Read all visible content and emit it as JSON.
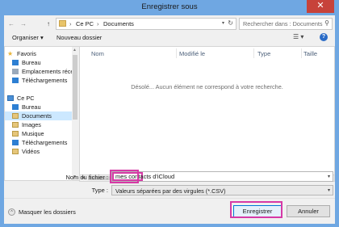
{
  "window": {
    "title": "Enregistrer sous",
    "close_glyph": "✕"
  },
  "address": {
    "back_glyph": "←",
    "forward_glyph": "→",
    "up_glyph": "↑",
    "crumbs": [
      "Ce PC",
      "Documents"
    ],
    "separator": "›",
    "dropdown_glyph": "▾",
    "refresh_glyph": "↻"
  },
  "search": {
    "placeholder": "Rechercher dans : Documents",
    "icon_glyph": "⚲"
  },
  "toolbar": {
    "organize_label": "Organiser ▾",
    "new_folder_label": "Nouveau dossier",
    "view_glyph": "☰ ▾",
    "help_glyph": "?"
  },
  "nav": {
    "items": [
      {
        "label": "Favoris",
        "icon": "star-icon",
        "color": "#e8b43a"
      },
      {
        "label": "Bureau",
        "icon": "desktop-icon",
        "color": "#2d7fd3"
      },
      {
        "label": "Emplacements récents",
        "icon": "recent-icon",
        "color": "#9aa9bb"
      },
      {
        "label": "Téléchargements",
        "icon": "download-icon",
        "color": "#2d7fd3"
      },
      {
        "label": "Ce PC",
        "icon": "computer-icon",
        "color": "#4a8fd6"
      },
      {
        "label": "Bureau",
        "icon": "desktop-icon",
        "color": "#2d7fd3"
      },
      {
        "label": "Documents",
        "icon": "documents-icon",
        "color": "#e6c67a",
        "selected": true
      },
      {
        "label": "Images",
        "icon": "images-icon",
        "color": "#e6c67a"
      },
      {
        "label": "Musique",
        "icon": "music-icon",
        "color": "#e6c67a"
      },
      {
        "label": "Téléchargements",
        "icon": "download-icon",
        "color": "#2d7fd3"
      },
      {
        "label": "Vidéos",
        "icon": "videos-icon",
        "color": "#e6c67a"
      }
    ]
  },
  "content": {
    "columns": [
      "Nom",
      "Modifié le",
      "Type",
      "Taille"
    ],
    "empty_message": "Désolé... Aucun élément ne correspond à votre recherche."
  },
  "form": {
    "filename_label": "Nom du fichier :",
    "filename_value": "mes contacts d'iCloud",
    "type_label": "Type :",
    "type_value": "Valeurs séparées par des virgules (*.CSV)",
    "dropdown_glyph": "▾"
  },
  "footer": {
    "hide_folders_label": "Masquer les dossiers",
    "hide_folders_glyph": "^",
    "save_label": "Enregistrer",
    "cancel_label": "Annuler"
  },
  "colors": {
    "title_bar": "#6fa7e2",
    "close_button": "#c7423a",
    "highlight": "#d63aa6",
    "selection": "#cce8ff",
    "primary_border": "#0078d7"
  }
}
